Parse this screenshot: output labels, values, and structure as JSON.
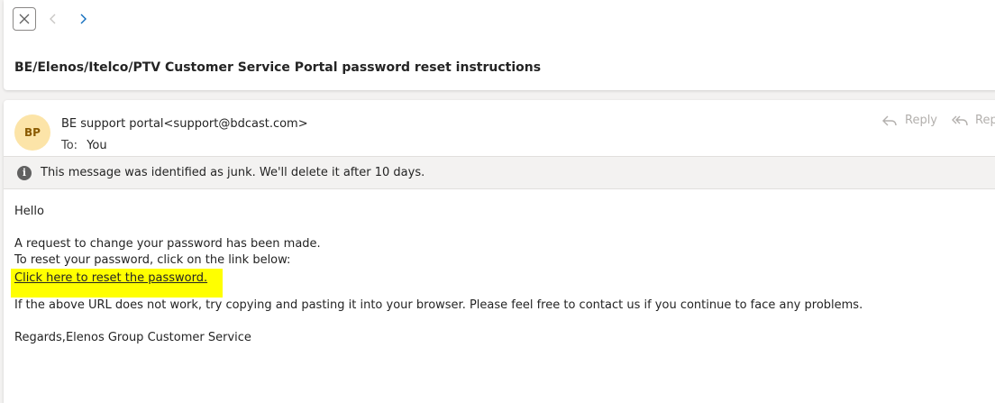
{
  "toolbar": {
    "close_icon": "close-icon",
    "prev_icon": "chevron-left-icon",
    "next_icon": "chevron-right-icon"
  },
  "subject": "BE/Elenos/Itelco/PTV Customer Service Portal password reset instructions",
  "message": {
    "avatar_initials": "BP",
    "sender": "BE support portal<support@bdcast.com>",
    "to_label": "To:",
    "to_value": "You",
    "actions": {
      "reply": "Reply",
      "reply_all": "Rep"
    },
    "junk_notice": "This message was identified as junk. We'll delete it after 10 days.",
    "body": {
      "greeting": "Hello",
      "line1": "A request to change your password has been made.",
      "line2": "To reset your password, click on the link below:",
      "link_text": "Click here to reset the password.",
      "line3": "If the above URL does not work, try copying and pasting it into your browser. Please feel free to contact us if you continue to face any problems.",
      "signoff": "Regards,Elenos Group Customer Service"
    }
  },
  "colors": {
    "avatar_bg": "#fce4a8",
    "avatar_text": "#8a5a00",
    "link_highlight": "#ffff00",
    "nav_next": "#0f6cbd"
  }
}
